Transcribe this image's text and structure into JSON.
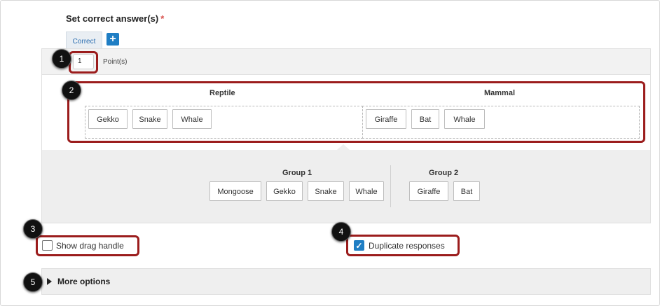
{
  "section": {
    "title": "Set correct answer(s)",
    "required_marker": "*"
  },
  "tabs": [
    {
      "label": "Correct"
    }
  ],
  "add_button": {
    "label": "+"
  },
  "points": {
    "value": "1",
    "label": "Point(s)"
  },
  "categories": [
    {
      "title": "Reptile",
      "items": [
        "Gekko",
        "Snake",
        "Whale"
      ]
    },
    {
      "title": "Mammal",
      "items": [
        "Giraffe",
        "Bat",
        "Whale"
      ]
    }
  ],
  "groups": [
    {
      "title": "Group 1",
      "items": [
        "Mongoose",
        "Gekko",
        "Snake",
        "Whale"
      ]
    },
    {
      "title": "Group 2",
      "items": [
        "Giraffe",
        "Bat"
      ]
    }
  ],
  "options": {
    "show_drag_handle": {
      "label": "Show drag handle",
      "checked": false
    },
    "duplicate_responses": {
      "label": "Duplicate responses",
      "checked": true,
      "check_glyph": "✓"
    }
  },
  "more_options": {
    "label": "More options"
  },
  "callouts": [
    "1",
    "2",
    "3",
    "4",
    "5"
  ],
  "colors": {
    "accent": "#1f7ec4",
    "callout_border": "#9b1c1c",
    "required": "#d9534f"
  }
}
